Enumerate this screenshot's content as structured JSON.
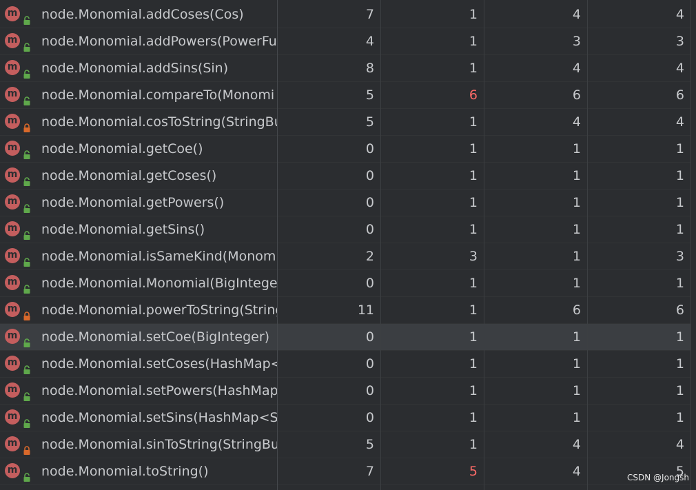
{
  "table": {
    "rows": [
      {
        "name": "node.Monomial.addCoses(Cos)",
        "visibility": "public",
        "values": [
          "7",
          "1",
          "4",
          "4"
        ],
        "highlight": [
          false,
          false,
          false,
          false
        ]
      },
      {
        "name": "node.Monomial.addPowers(PowerFu",
        "visibility": "public",
        "values": [
          "4",
          "1",
          "3",
          "3"
        ],
        "highlight": [
          false,
          false,
          false,
          false
        ]
      },
      {
        "name": "node.Monomial.addSins(Sin)",
        "visibility": "public",
        "values": [
          "8",
          "1",
          "4",
          "4"
        ],
        "highlight": [
          false,
          false,
          false,
          false
        ]
      },
      {
        "name": "node.Monomial.compareTo(Monomi",
        "visibility": "public",
        "values": [
          "5",
          "6",
          "6",
          "6"
        ],
        "highlight": [
          false,
          true,
          false,
          false
        ]
      },
      {
        "name": "node.Monomial.cosToString(StringBu",
        "visibility": "private",
        "values": [
          "5",
          "1",
          "4",
          "4"
        ],
        "highlight": [
          false,
          false,
          false,
          false
        ]
      },
      {
        "name": "node.Monomial.getCoe()",
        "visibility": "public",
        "values": [
          "0",
          "1",
          "1",
          "1"
        ],
        "highlight": [
          false,
          false,
          false,
          false
        ]
      },
      {
        "name": "node.Monomial.getCoses()",
        "visibility": "public",
        "values": [
          "0",
          "1",
          "1",
          "1"
        ],
        "highlight": [
          false,
          false,
          false,
          false
        ]
      },
      {
        "name": "node.Monomial.getPowers()",
        "visibility": "public",
        "values": [
          "0",
          "1",
          "1",
          "1"
        ],
        "highlight": [
          false,
          false,
          false,
          false
        ]
      },
      {
        "name": "node.Monomial.getSins()",
        "visibility": "public",
        "values": [
          "0",
          "1",
          "1",
          "1"
        ],
        "highlight": [
          false,
          false,
          false,
          false
        ]
      },
      {
        "name": "node.Monomial.isSameKind(Monomi",
        "visibility": "public",
        "values": [
          "2",
          "3",
          "1",
          "3"
        ],
        "highlight": [
          false,
          false,
          false,
          false
        ]
      },
      {
        "name": "node.Monomial.Monomial(BigIntege",
        "visibility": "public",
        "values": [
          "0",
          "1",
          "1",
          "1"
        ],
        "highlight": [
          false,
          false,
          false,
          false
        ]
      },
      {
        "name": "node.Monomial.powerToString(String",
        "visibility": "private",
        "values": [
          "11",
          "1",
          "6",
          "6"
        ],
        "highlight": [
          false,
          false,
          false,
          false
        ]
      },
      {
        "name": "node.Monomial.setCoe(BigInteger)",
        "visibility": "public",
        "values": [
          "0",
          "1",
          "1",
          "1"
        ],
        "highlight": [
          false,
          false,
          false,
          false
        ],
        "selected": true
      },
      {
        "name": "node.Monomial.setCoses(HashMap<",
        "visibility": "public",
        "values": [
          "0",
          "1",
          "1",
          "1"
        ],
        "highlight": [
          false,
          false,
          false,
          false
        ]
      },
      {
        "name": "node.Monomial.setPowers(HashMap",
        "visibility": "public",
        "values": [
          "0",
          "1",
          "1",
          "1"
        ],
        "highlight": [
          false,
          false,
          false,
          false
        ]
      },
      {
        "name": "node.Monomial.setSins(HashMap<St",
        "visibility": "public",
        "values": [
          "0",
          "1",
          "1",
          "1"
        ],
        "highlight": [
          false,
          false,
          false,
          false
        ]
      },
      {
        "name": "node.Monomial.sinToString(StringBu",
        "visibility": "private",
        "values": [
          "5",
          "1",
          "4",
          "4"
        ],
        "highlight": [
          false,
          false,
          false,
          false
        ]
      },
      {
        "name": "node.Monomial.toString()",
        "visibility": "public",
        "values": [
          "7",
          "5",
          "4",
          "5"
        ],
        "highlight": [
          false,
          true,
          false,
          false
        ]
      }
    ]
  },
  "icons": {
    "method": "method-icon",
    "method_letter": "m",
    "public": "unlocked-icon",
    "private": "locked-icon"
  },
  "colors": {
    "method_icon": "#c45e5e",
    "public_lock": "#5fa84b",
    "private_lock": "#d9692b",
    "highlight_value": "#ff6b68"
  },
  "watermark": "CSDN @Jongsh"
}
